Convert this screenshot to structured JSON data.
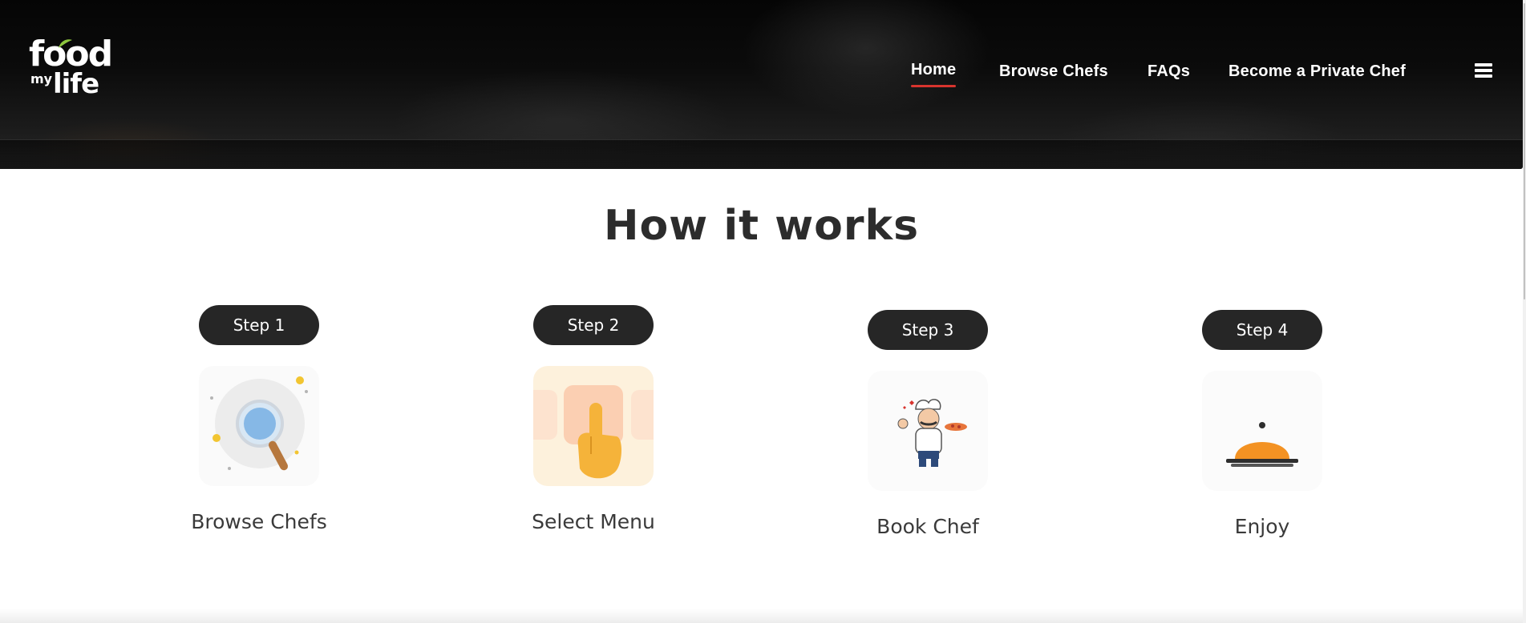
{
  "logo": {
    "line1": "food",
    "line2_small": "my",
    "line2": "life"
  },
  "nav": {
    "items": [
      {
        "label": "Home",
        "active": true
      },
      {
        "label": "Browse Chefs",
        "active": false
      },
      {
        "label": "FAQs",
        "active": false
      },
      {
        "label": "Become a Private Chef",
        "active": false
      }
    ],
    "accent_color": "#d8342e",
    "menu_icon": "hamburger-icon"
  },
  "section": {
    "title": "How it works",
    "steps": [
      {
        "pill": "Step 1",
        "label": "Browse Chefs",
        "icon": "magnifier-icon"
      },
      {
        "pill": "Step 2",
        "label": "Select Menu",
        "icon": "pointing-hand-icon"
      },
      {
        "pill": "Step 3",
        "label": "Book Chef",
        "icon": "chef-icon"
      },
      {
        "pill": "Step 4",
        "label": "Enjoy",
        "icon": "cloche-icon"
      }
    ]
  },
  "colors": {
    "pill_bg": "#262626",
    "cloche": "#f39223",
    "step2_bg": "#fdf1dc"
  }
}
